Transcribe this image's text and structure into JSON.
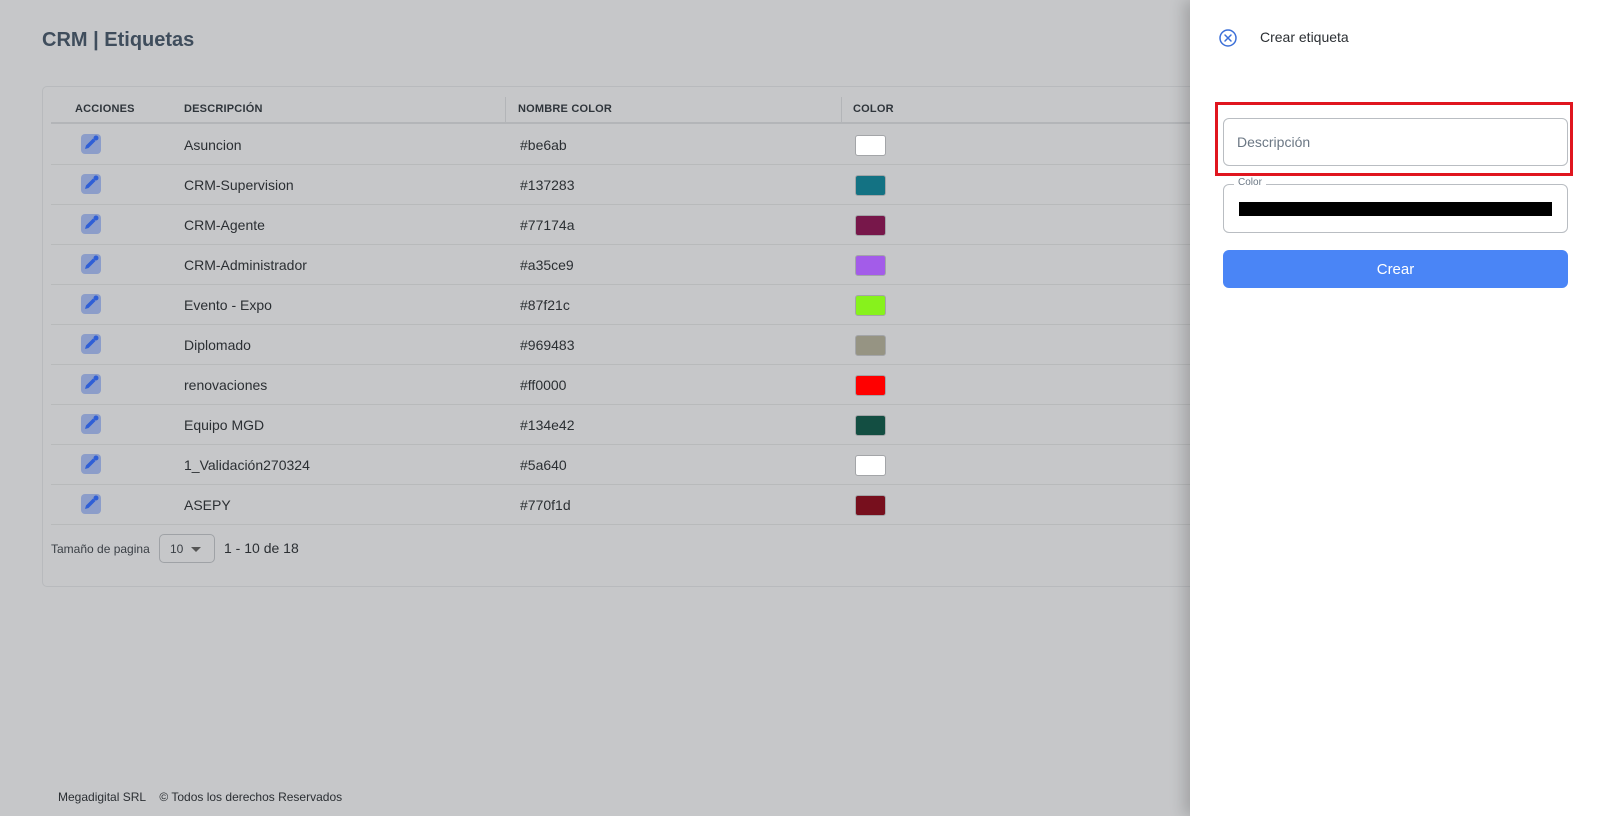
{
  "page": {
    "title": "CRM | Etiquetas"
  },
  "table": {
    "headers": {
      "actions": "ACCIONES",
      "description": "DESCRIPCIÓN",
      "color_name": "NOMBRE COLOR",
      "color": "COLOR"
    },
    "edit_icon": "edit-pencil-icon",
    "rows": [
      {
        "description": "Asuncion",
        "color_name": "#be6ab",
        "swatch": "#ffffff"
      },
      {
        "description": "CRM-Supervision",
        "color_name": "#137283",
        "swatch": "#137283"
      },
      {
        "description": "CRM-Agente",
        "color_name": "#77174a",
        "swatch": "#77174a"
      },
      {
        "description": "CRM-Administrador",
        "color_name": "#a35ce9",
        "swatch": "#a35ce9"
      },
      {
        "description": "Evento - Expo",
        "color_name": "#87f21c",
        "swatch": "#87f21c"
      },
      {
        "description": "Diplomado",
        "color_name": "#969483",
        "swatch": "#969483"
      },
      {
        "description": "renovaciones",
        "color_name": "#ff0000",
        "swatch": "#ff0000"
      },
      {
        "description": "Equipo MGD",
        "color_name": "#134e42",
        "swatch": "#134e42"
      },
      {
        "description": "1_Validación270324",
        "color_name": "#5a640",
        "swatch": "#ffffff"
      },
      {
        "description": "ASEPY",
        "color_name": "#770f1d",
        "swatch": "#770f1d"
      }
    ]
  },
  "pager": {
    "label": "Tamaño de pagina",
    "page_size": "10",
    "range": "1 - 10 de 18"
  },
  "footer": {
    "company": "Megadigital SRL",
    "rights": "© Todos los derechos Reservados"
  },
  "drawer": {
    "title": "Crear etiqueta",
    "close_icon": "close-circle-icon",
    "description_placeholder": "Descripción",
    "color_label": "Color",
    "color_value": "#000000",
    "create_label": "Crear",
    "accent": "#4a85f6",
    "highlight_color": "#e0161f"
  }
}
